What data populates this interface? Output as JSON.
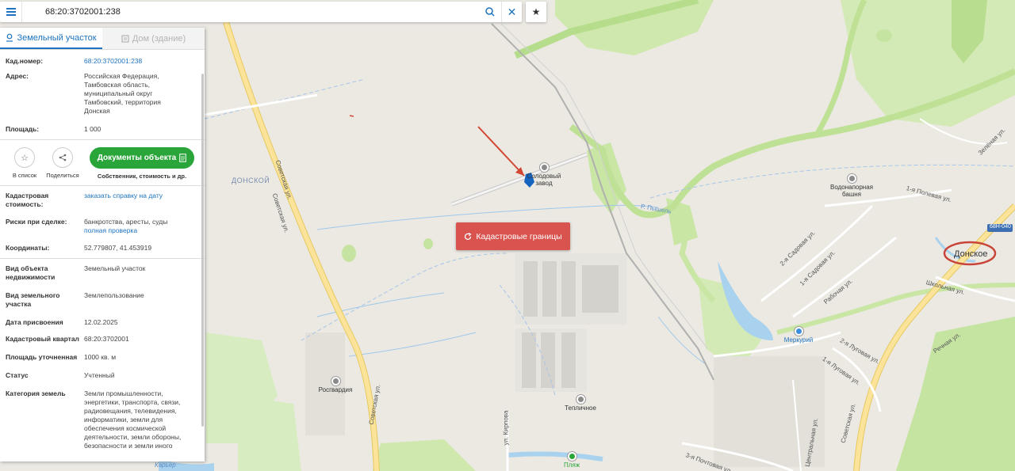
{
  "search": {
    "value": "68:20:3702001:238",
    "clear_glyph": "✕",
    "star_glyph": "★"
  },
  "tabs": [
    {
      "label": "Земельный участок",
      "icon": "parcel-icon",
      "active": true
    },
    {
      "label": "Дом (здание)",
      "icon": "building-icon",
      "active": false
    }
  ],
  "info": {
    "cad_number": {
      "label": "Кад.номер:",
      "value": "68:20:3702001:238"
    },
    "address": {
      "label": "Адрес:",
      "value": "Российская Федерация, Тамбовская область, муниципальный округ Тамбовский, территория Донская"
    },
    "area": {
      "label": "Площадь:",
      "value": "1 000"
    }
  },
  "actions": {
    "list_label": "В список",
    "share_label": "Поделиться",
    "docs_label": "Документы объекта",
    "docs_sub": "Собственник, стоимость и др."
  },
  "details": {
    "cad_cost": {
      "label": "Кадастровая стоимость:",
      "value": "заказать справку на дату"
    },
    "risks": {
      "label": "Риски при сделке:",
      "value": "банкротства, аресты, суды",
      "link": "полная проверка"
    },
    "coords": {
      "label": "Координаты:",
      "value": "52.779807, 41.453919"
    }
  },
  "attributes": [
    {
      "label": "Вид объекта недвижимости",
      "value": "Земельный участок"
    },
    {
      "label": "Вид земельного участка",
      "value": "Землепользование"
    },
    {
      "label": "Дата присвоения",
      "value": "12.02.2025"
    },
    {
      "label": "Кадастровый квартал",
      "value": "68:20:3702001"
    },
    {
      "label": "Площадь уточненная",
      "value": "1000 кв. м"
    },
    {
      "label": "Статус",
      "value": "Учтенный"
    },
    {
      "label": "Категория земель",
      "value": "Земли промышленности, энергетики, транспорта, связи, радиовещания, телевидения, информатики, земли для обеспечения космической деятельности, земли обороны, безопасности и земли иного"
    }
  ],
  "map": {
    "cad_borders_button": "Кадастровые границы",
    "labels": {
      "donskoy": "ДОНСКОЙ",
      "donskoe": "Донское",
      "sovetskaya": "Советская ул.",
      "pyshel": "Р. Пышель",
      "road_code": "68Н-040",
      "koltsevaya": "1-я Полевая ул.",
      "sadovaya2": "2-я Садовая ул.",
      "sadovaya1": "1-я Садовая ул.",
      "rabochaya": "Рабочая ул.",
      "shkolnaya": "Школьная ул.",
      "lugovaya2": "2-я Луговая ул.",
      "lugovaya1": "1-я Луговая ул.",
      "rechnaya": "Речная ул.",
      "zelenaya": "Зелёная ул.",
      "pochtovaya": "3-я Почтовая ул.",
      "tsentralnaya": "Центральная ул.",
      "kirtova": "ул. Кирпова",
      "karier": "Карьер"
    },
    "pois": [
      {
        "name": "Солодовый завод",
        "icon": "factory-icon"
      },
      {
        "name": "Водонапорная башня",
        "icon": "tower-icon"
      },
      {
        "name": "Росгвардия",
        "icon": "guard-icon"
      },
      {
        "name": "Тепличное",
        "icon": "greenhouse-icon"
      },
      {
        "name": "Меркурий",
        "icon": "shop-icon"
      },
      {
        "name": "Пляж",
        "icon": "beach-icon"
      }
    ],
    "colors": {
      "water": "#a9d2ef",
      "forest": "#c8e6a6",
      "road": "#f5dd80",
      "accent": "#1e73be",
      "button": "#d9534f",
      "docs": "#2aa53a"
    }
  }
}
